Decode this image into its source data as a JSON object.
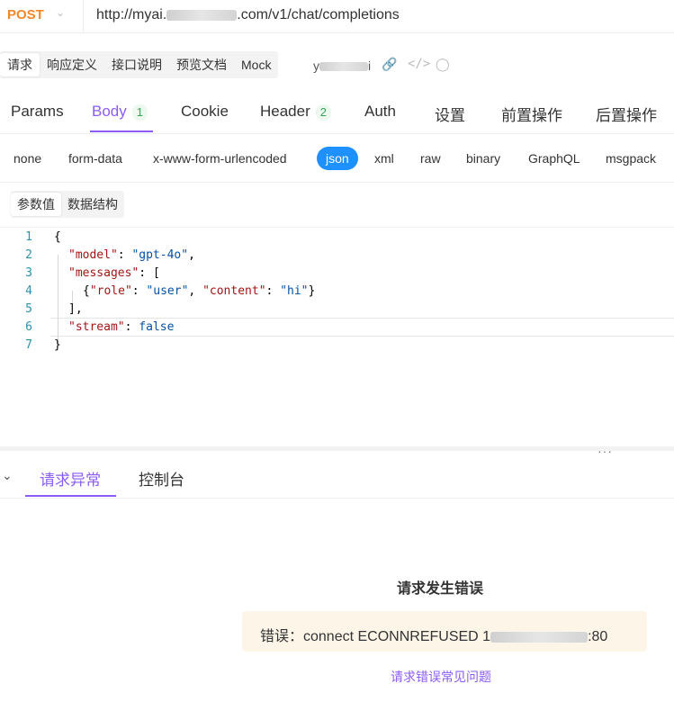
{
  "request": {
    "method": "POST",
    "url_prefix": "http://myai.",
    "url_suffix": ".com/v1/chat/completions"
  },
  "doc_tabs": [
    "请求",
    "响应定义",
    "接口说明",
    "预览文档",
    "Mock"
  ],
  "api_name_visible": "y",
  "api_name_tail": "i",
  "param_tabs": {
    "params": "Params",
    "body": "Body",
    "body_count": "1",
    "cookie": "Cookie",
    "header": "Header",
    "header_count": "2",
    "auth": "Auth",
    "settings": "设置",
    "pre": "前置操作",
    "post": "后置操作"
  },
  "body_types": [
    "none",
    "form-data",
    "x-www-form-urlencoded",
    "json",
    "xml",
    "raw",
    "binary",
    "GraphQL",
    "msgpack"
  ],
  "body_active": "json",
  "value_tabs": [
    "参数值",
    "数据结构"
  ],
  "editor": {
    "line_numbers": [
      "1",
      "2",
      "3",
      "4",
      "5",
      "6",
      "7"
    ],
    "open_brace": "{",
    "close_brace": "}",
    "key_model": "\"model\"",
    "val_model": "\"gpt-4o\"",
    "key_messages": "\"messages\"",
    "open_bracket": "[",
    "msg_open": "{",
    "key_role": "\"role\"",
    "val_role": "\"user\"",
    "key_content": "\"content\"",
    "val_content": "\"hi\"",
    "msg_close": "}",
    "close_bracket": "],",
    "key_stream": "\"stream\"",
    "val_stream": "false"
  },
  "response_tabs": [
    "请求异常",
    "控制台"
  ],
  "error": {
    "title": "请求发生错误",
    "message_prefix": "错误：connect ECONNREFUSED ",
    "message_visible_ip_start": "1",
    "message_suffix": ":80",
    "faq_link": "请求错误常见问题"
  }
}
